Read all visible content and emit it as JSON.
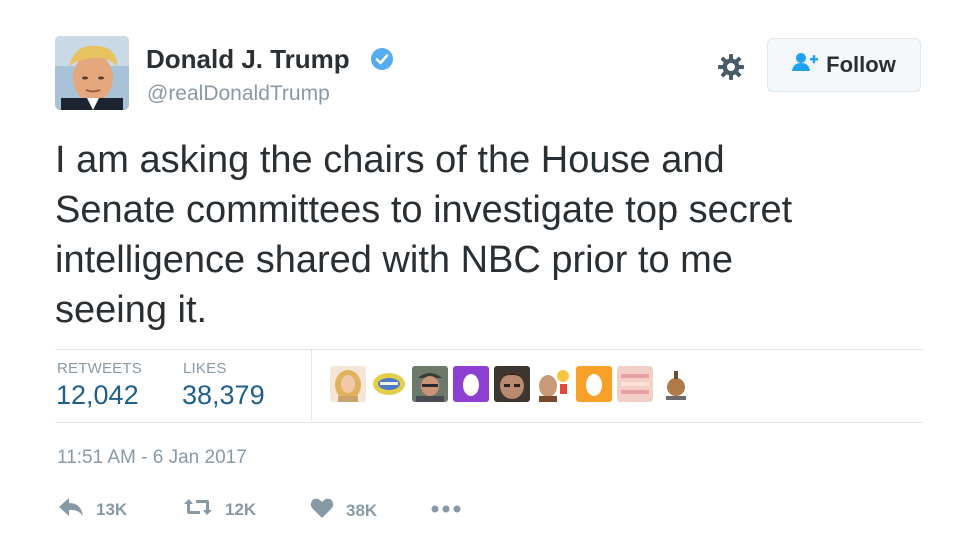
{
  "header": {
    "display_name": "Donald J. Trump",
    "handle": "@realDonaldTrump",
    "follow_label": "Follow"
  },
  "tweet": {
    "text": "I am asking the chairs of the House and\nSenate committees to investigate top secret\nintelligence shared with NBC prior to me\nseeing it.",
    "timestamp": "11:51 AM - 6 Jan 2017"
  },
  "stats": {
    "retweets_label": "RETWEETS",
    "retweets_value": "12,042",
    "likes_label": "LIKES",
    "likes_value": "38,379"
  },
  "liker_avatars": [
    {
      "icon": "avatar-blonde-woman",
      "color": "#e8c28a"
    },
    {
      "icon": "avatar-logo-badge",
      "color": "#d9c356"
    },
    {
      "icon": "avatar-man-cap",
      "color": "#8a7a6a"
    },
    {
      "icon": "avatar-default-egg",
      "color": "#8d3fd1"
    },
    {
      "icon": "avatar-man-face",
      "color": "#5a4a40"
    },
    {
      "icon": "avatar-man-emoji",
      "color": "#c89a6a"
    },
    {
      "icon": "avatar-default-egg",
      "color": "#f7a12a"
    },
    {
      "icon": "avatar-pink-graphic",
      "color": "#f0c2c0"
    },
    {
      "icon": "avatar-small-object",
      "color": "#b89070"
    }
  ],
  "actions": {
    "reply_count": "13K",
    "retweet_count": "12K",
    "like_count": "38K"
  },
  "colors": {
    "text": "#292f33",
    "muted": "#8899a6",
    "link_blue": "#1e5f8c",
    "verified_blue": "#55acee",
    "border": "#e1e8ed"
  }
}
